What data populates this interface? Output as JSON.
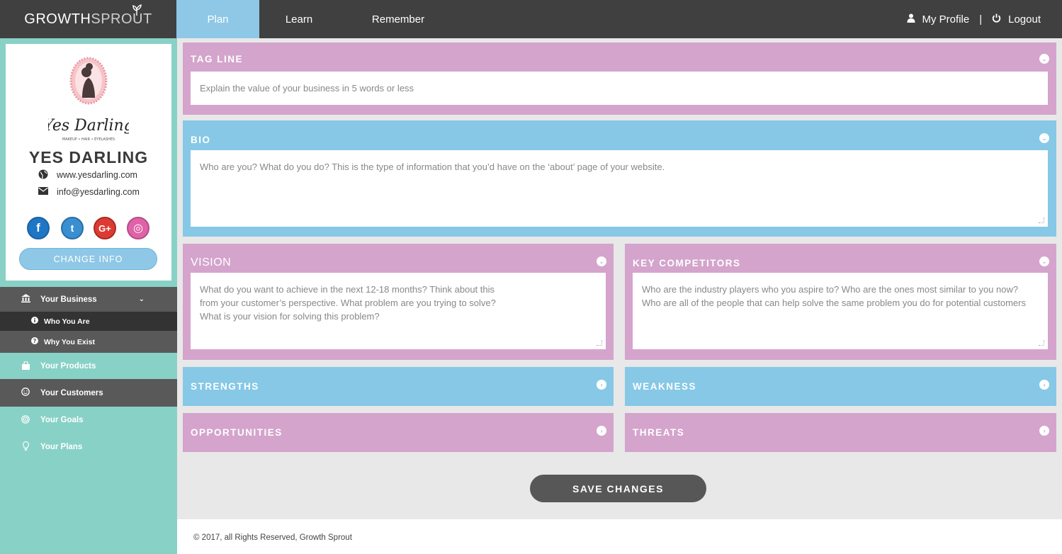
{
  "colors": {
    "topbar": "#404040",
    "accent_blue": "#86c8e6",
    "accent_pink": "#d4a4cc",
    "sidebar_teal": "#88d1c6",
    "sidebar_dark": "#595959"
  },
  "header": {
    "brand_part1": "GROWTH",
    "brand_part2": "SPROUT",
    "tabs": [
      {
        "label": "Plan",
        "active": true
      },
      {
        "label": "Learn",
        "active": false
      },
      {
        "label": "Remember",
        "active": false
      }
    ],
    "profile_label": "My Profile",
    "separator": "|",
    "logout_label": "Logout",
    "icons": {
      "profile": "user-icon",
      "logout": "power-icon"
    }
  },
  "sidebar": {
    "logo_script": "Yes Darling",
    "logo_tagline": "MAKEUP • HAIR • EYELASHES",
    "business_name": "YES DARLING",
    "website": "www.yesdarling.com",
    "email": "info@yesdarling.com",
    "socials": [
      {
        "name": "facebook-icon",
        "glyph": "f",
        "color": "#1e76c5"
      },
      {
        "name": "twitter-icon",
        "glyph": "t",
        "color": "#3a8fd0"
      },
      {
        "name": "google-plus-icon",
        "glyph": "G+",
        "color": "#dc3b33"
      },
      {
        "name": "instagram-icon",
        "glyph": "◎",
        "color": "#e062a7"
      }
    ],
    "change_info_label": "CHANGE INFO",
    "nav": {
      "business": "Your Business",
      "who": "Who You Are",
      "why": "Why You Exist",
      "products": "Your Products",
      "customers": "Your Customers",
      "goals": "Your Goals",
      "plans": "Your Plans"
    }
  },
  "main": {
    "tagline": {
      "title": "TAG LINE",
      "placeholder": "Explain the value of your business in 5 words or less"
    },
    "bio": {
      "title": "BIO",
      "placeholder": "Who are you? What do you do? This is the type of information that you’d have on the ‘about’ page of your website."
    },
    "vision": {
      "title": "VISION",
      "placeholder": "What do you want to achieve in the next 12-18 months? Think about this from your customer’s perspective. What problem are you trying to solve? What is your vision for solving this problem?"
    },
    "competitors": {
      "title": "KEY COMPETITORS",
      "placeholder": "Who are the industry players who you aspire to? Who are the ones most similar to you now? Who are all of the people that can help solve the same problem you do for potential customers"
    },
    "strengths": {
      "title": "STRENGTHS"
    },
    "weakness": {
      "title": "WEAKNESS"
    },
    "opportunities": {
      "title": "OPPORTUNITIES"
    },
    "threats": {
      "title": "THREATS"
    },
    "save_label": "SAVE CHANGES"
  },
  "footer": {
    "text": "© 2017, all Rights Reserved, Growth Sprout"
  }
}
